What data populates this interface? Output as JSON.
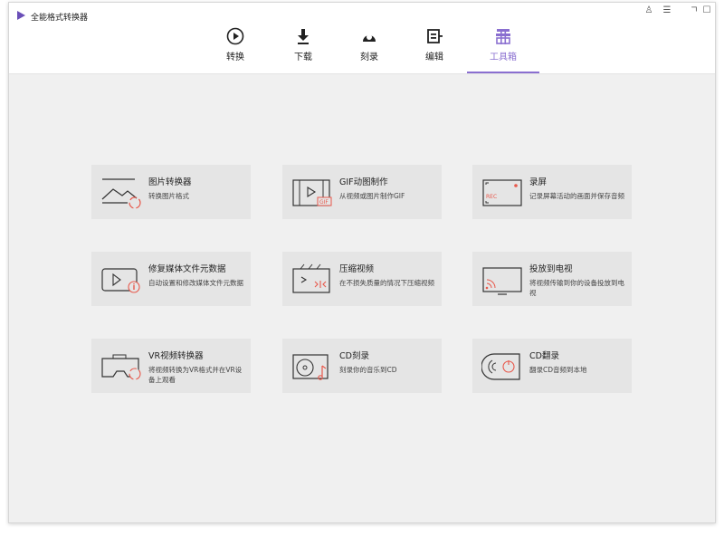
{
  "app": {
    "title": "全能格式转换器"
  },
  "window_controls": {
    "user": "♙",
    "menu": "☰",
    "minimize": "ㄱ",
    "maximize": "☐"
  },
  "tabs": [
    {
      "label": "转换",
      "icon": "play-circle-icon"
    },
    {
      "label": "下载",
      "icon": "download-icon"
    },
    {
      "label": "刻录",
      "icon": "record-icon"
    },
    {
      "label": "编辑",
      "icon": "edit-icon"
    },
    {
      "label": "工具箱",
      "icon": "toolbox-icon",
      "active": true
    }
  ],
  "tools": [
    {
      "title": "图片转换器",
      "desc": "转换图片格式",
      "icon": "image-convert-icon"
    },
    {
      "title": "GIF动图制作",
      "desc": "从视频或图片制作GIF",
      "icon": "gif-maker-icon"
    },
    {
      "title": "录屏",
      "desc": "记录屏幕活动的画面并保存音频",
      "icon": "screen-record-icon"
    },
    {
      "title": "修复媒体文件元数据",
      "desc": "自动设置和修改媒体文件元数据",
      "icon": "metadata-fix-icon"
    },
    {
      "title": "压缩视频",
      "desc": "在不损失质量的情况下压缩视频",
      "icon": "compress-video-icon"
    },
    {
      "title": "投放到电视",
      "desc": "将视频传输到你的设备投放到电视",
      "icon": "cast-tv-icon"
    },
    {
      "title": "VR视频转换器",
      "desc": "将视频转换为VR格式并在VR设备上观看",
      "icon": "vr-convert-icon"
    },
    {
      "title": "CD刻录",
      "desc": "刻录你的音乐到CD",
      "icon": "cd-burn-icon"
    },
    {
      "title": "CD翻录",
      "desc": "翻录CD音频到本地",
      "icon": "cd-rip-icon"
    }
  ],
  "colors": {
    "accent": "#8a6fd0",
    "icon_red": "#e8584b",
    "card_bg": "#e5e5e5",
    "content_bg": "#f0f0f0"
  }
}
